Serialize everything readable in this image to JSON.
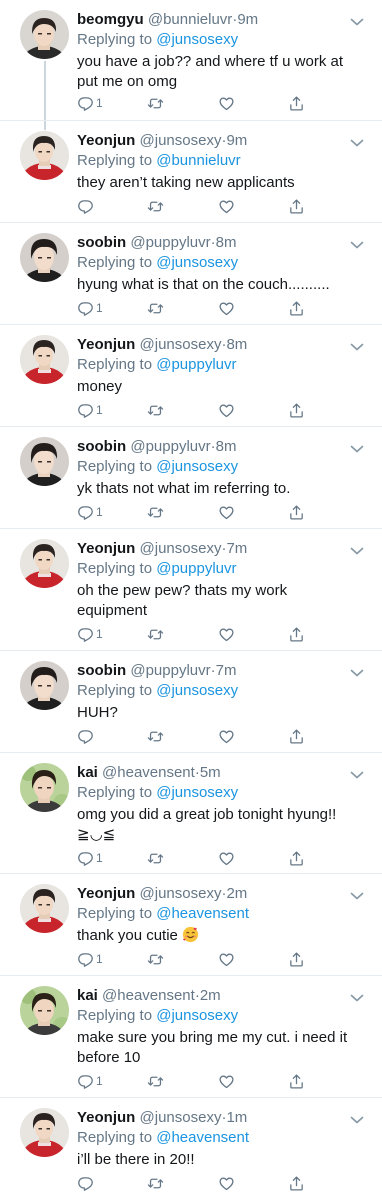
{
  "thread": {
    "tweets": [
      {
        "name": "beomgyu",
        "handle": "@bunnieluvr",
        "dot": "·",
        "time": "9m",
        "reply_prefix": "Replying to",
        "reply_to": "@junsosexy",
        "lines": [
          "you have a job?? and where tf u work at",
          "put me on omg"
        ],
        "emoji": "",
        "reply_count": "1",
        "avatar": "beomgyu"
      },
      {
        "name": "Yeonjun",
        "handle": "@junsosexy",
        "dot": "·",
        "time": "9m",
        "reply_prefix": "Replying to",
        "reply_to": "@bunnieluvr",
        "lines": [
          "they aren’t taking new applicants"
        ],
        "emoji": "",
        "reply_count": "",
        "avatar": "yeonjun"
      },
      {
        "name": "soobin",
        "handle": "@puppyluvr",
        "dot": "·",
        "time": "8m",
        "reply_prefix": "Replying to",
        "reply_to": "@junsosexy",
        "lines": [
          "hyung what is that on the couch.........."
        ],
        "emoji": "",
        "reply_count": "1",
        "avatar": "soobin"
      },
      {
        "name": "Yeonjun",
        "handle": "@junsosexy",
        "dot": "·",
        "time": "8m",
        "reply_prefix": "Replying to",
        "reply_to": "@puppyluvr",
        "lines": [
          "money"
        ],
        "emoji": "",
        "reply_count": "1",
        "avatar": "yeonjun"
      },
      {
        "name": "soobin",
        "handle": "@puppyluvr",
        "dot": "·",
        "time": "8m",
        "reply_prefix": "Replying to",
        "reply_to": "@junsosexy",
        "lines": [
          "yk thats not what im referring to."
        ],
        "emoji": "",
        "reply_count": "1",
        "avatar": "soobin"
      },
      {
        "name": "Yeonjun",
        "handle": "@junsosexy",
        "dot": "·",
        "time": "7m",
        "reply_prefix": "Replying to",
        "reply_to": "@puppyluvr",
        "lines": [
          "oh the pew pew? thats my work",
          "equipment"
        ],
        "emoji": "",
        "reply_count": "1",
        "avatar": "yeonjun"
      },
      {
        "name": "soobin",
        "handle": "@puppyluvr",
        "dot": "·",
        "time": "7m",
        "reply_prefix": "Replying to",
        "reply_to": "@junsosexy",
        "lines": [
          "HUH?"
        ],
        "emoji": "",
        "reply_count": "",
        "avatar": "soobin"
      },
      {
        "name": "kai",
        "handle": "@heavensent",
        "dot": "·",
        "time": "5m",
        "reply_prefix": "Replying to",
        "reply_to": "@junsosexy",
        "lines": [
          "omg you did a great job tonight hyung!!",
          "≧◡≦"
        ],
        "emoji": "",
        "reply_count": "1",
        "avatar": "kai"
      },
      {
        "name": "Yeonjun",
        "handle": "@junsosexy",
        "dot": "·",
        "time": "2m",
        "reply_prefix": "Replying to",
        "reply_to": "@heavensent",
        "lines": [
          "thank you cutie"
        ],
        "emoji": "smiling-face-with-hearts",
        "reply_count": "1",
        "avatar": "yeonjun"
      },
      {
        "name": "kai",
        "handle": "@heavensent",
        "dot": "·",
        "time": "2m",
        "reply_prefix": "Replying to",
        "reply_to": "@junsosexy",
        "lines": [
          "make sure you bring me my cut. i need it",
          "before 10"
        ],
        "emoji": "",
        "reply_count": "1",
        "avatar": "kai"
      },
      {
        "name": "Yeonjun",
        "handle": "@junsosexy",
        "dot": "·",
        "time": "1m",
        "reply_prefix": "Replying to",
        "reply_to": "@heavensent",
        "lines": [
          "i’ll be there in 20!!"
        ],
        "emoji": "",
        "reply_count": "",
        "avatar": "yeonjun"
      }
    ]
  },
  "icons": {
    "reply": "reply-icon",
    "retweet": "retweet-icon",
    "like": "like-icon",
    "share": "share-icon",
    "more": "chevron-down-icon"
  },
  "colors": {
    "name": "#14171a",
    "secondary": "#657786",
    "mention": "#1b95e0",
    "divider": "#e6ecf0",
    "thread_line": "#ccd6dd"
  }
}
